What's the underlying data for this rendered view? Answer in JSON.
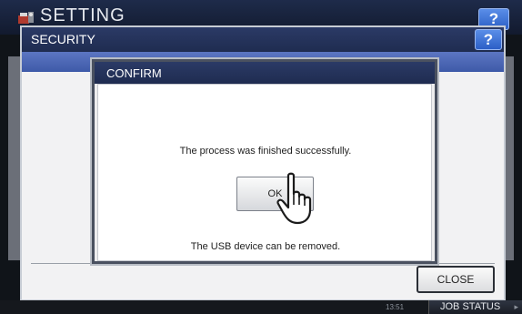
{
  "app": {
    "title": "SETTING",
    "help_label": "?"
  },
  "window": {
    "title": "SECURITY",
    "help_label": "?",
    "close_label": "CLOSE"
  },
  "dialog": {
    "title": "CONFIRM",
    "message": "The process was finished successfully.",
    "ok_label": "OK",
    "note": "The USB device can be removed."
  },
  "status_bar": {
    "time": "13:51",
    "job_status_label": "JOB STATUS",
    "job_status_arrow": "▸"
  },
  "icons": [
    "setting-app-icon",
    "hand-pointer-icon",
    "help-icon"
  ],
  "colors": {
    "title_bar": "#1f2c50",
    "strip": "#4a65b3",
    "help_button": "#3b6fd8"
  }
}
